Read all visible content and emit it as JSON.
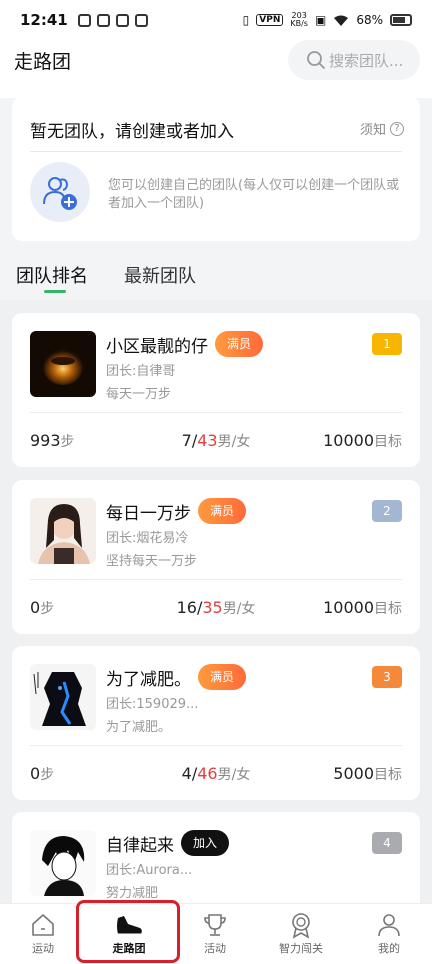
{
  "status": {
    "time": "12:41",
    "vpn": "VPN",
    "speed_top": "203",
    "speed_bottom": "KB/s",
    "battery": "68%"
  },
  "header": {
    "title": "走路团",
    "search_placeholder": "搜索团队..."
  },
  "noteam": {
    "title": "暂无团队，请创建或者加入",
    "notice": "须知",
    "description": "您可以创建自己的团队(每人仅可以创建一个团队或者加入一个团队)"
  },
  "tabs": [
    {
      "label": "团队排名"
    },
    {
      "label": "最新团队"
    }
  ],
  "teams": [
    {
      "name": "小区最靓的仔",
      "badge": "满员",
      "leader": "团长:自律哥",
      "motto": "每天一万步",
      "rank": "1",
      "steps": "993",
      "steps_unit": "步",
      "male": "7",
      "female": "43",
      "gender_unit": "男/女",
      "goal": "10000",
      "goal_unit": "目标"
    },
    {
      "name": "每日一万步",
      "badge": "满员",
      "leader": "团长:烟花易冷",
      "motto": "坚持每天一万步",
      "rank": "2",
      "steps": "0",
      "steps_unit": "步",
      "male": "16",
      "female": "35",
      "gender_unit": "男/女",
      "goal": "10000",
      "goal_unit": "目标"
    },
    {
      "name": "为了减肥。",
      "badge": "满员",
      "leader": "团长:159029...",
      "motto": "为了减肥。",
      "rank": "3",
      "steps": "0",
      "steps_unit": "步",
      "male": "4",
      "female": "46",
      "gender_unit": "男/女",
      "goal": "5000",
      "goal_unit": "目标"
    },
    {
      "name": "自律起来",
      "badge": "加入",
      "leader": "团长:Aurora...",
      "motto": "努力减肥",
      "rank": "4"
    }
  ],
  "nav": [
    {
      "label": "运动",
      "icon": "home-icon"
    },
    {
      "label": "走路团",
      "icon": "sneaker-icon"
    },
    {
      "label": "活动",
      "icon": "trophy-icon"
    },
    {
      "label": "智力闯关",
      "icon": "medal-icon"
    },
    {
      "label": "我的",
      "icon": "person-icon"
    }
  ],
  "colors": {
    "accent_green": "#34b56a",
    "badge_orange": "#ff7a3a",
    "female_red": "#e04040",
    "highlight_red": "#d8202a"
  }
}
